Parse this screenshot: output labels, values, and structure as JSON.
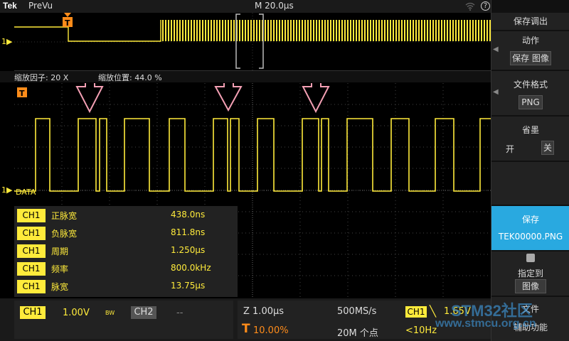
{
  "topbar": {
    "brand": "Tek",
    "mode": "PreVu",
    "timebase": "M 20.0µs",
    "help_label": "?"
  },
  "overview": {
    "trigger_label": "T",
    "channel_marker": "1▶"
  },
  "zoominfo": {
    "factor": "缩放因子: 20 X",
    "position": "缩放位置: 44.0 %"
  },
  "main": {
    "channel_marker": "1▶",
    "data_label": "DATA",
    "trigger_label": "T"
  },
  "measurements": [
    {
      "ch": "CH1",
      "name": "正脉宽",
      "value": "438.0ns"
    },
    {
      "ch": "CH1",
      "name": "负脉宽",
      "value": "811.8ns"
    },
    {
      "ch": "CH1",
      "name": "周期",
      "value": "1.250µs"
    },
    {
      "ch": "CH1",
      "name": "频率",
      "value": "800.0kHz"
    },
    {
      "ch": "CH1",
      "name": "脉宽",
      "value": "13.75µs"
    }
  ],
  "bottombar": {
    "ch1_label": "CH1",
    "ch1_scale": "1.00V",
    "bw_label": "BW",
    "ch2_label": "CH2",
    "ch2_scale": "--",
    "zoom_scale": "Z 1.00µs",
    "trigger_pos": "10.00%",
    "trigger_icon": "T",
    "sample_rate": "500MS/s",
    "record_length": "20M 个点",
    "trig_source": "CH1",
    "trig_slope": "╲",
    "trig_level": "1.65V",
    "trig_freq": "<10Hz"
  },
  "sidemenu": {
    "header": "保存调出",
    "action_title": "动作",
    "action_value": "保存 图像",
    "format_title": "文件格式",
    "format_value": "PNG",
    "inksaver_title": "省墨",
    "inksaver_on": "开",
    "inksaver_off": "关",
    "save_title": "保存",
    "save_file": "TEK00000.PNG",
    "assign_title": "指定到",
    "assign_value": "图像",
    "file_util_1": "文件",
    "file_util_2": "辅助功能"
  },
  "watermark": {
    "line1": "STM32社区",
    "line2": "www.stmcu.org.cn"
  },
  "colors": {
    "trace": "#ffeb3b",
    "save_accent": "#29a9e0",
    "arrow_pink": "#f4a0b4"
  }
}
